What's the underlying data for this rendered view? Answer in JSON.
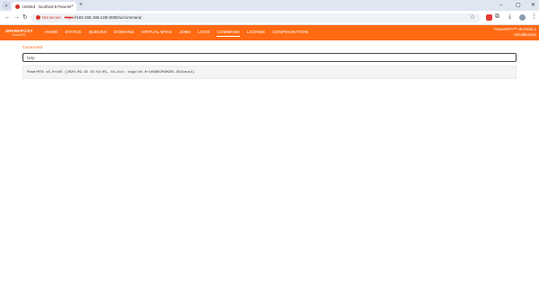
{
  "browser": {
    "tab_title": "Untitled - localhost:8 PowerMTA Web...",
    "new_tab_symbol": "+",
    "security_warning": "Not secure",
    "url_scheme": "https",
    "url_rest": "://192.168.198.128/:8080/ui/command",
    "window_controls": [
      "–",
      "▢",
      "✕"
    ]
  },
  "app": {
    "logo": "SPARKP☉ST",
    "logo_sub": "PowerMTA",
    "nav": [
      "HOME",
      "STATUS",
      "QUEUES",
      "DOMAINS",
      "VIRTUAL MTAS",
      "JOBS",
      "LOGS",
      "COMMAND",
      "LICENSE",
      "CONFIGURATION"
    ],
    "active_nav": "COMMAND",
    "version_line1": "PowerMTA™ v6.0r1b5.1",
    "version_line2": "r.localdomain"
  },
  "command": {
    "section_title": "Command",
    "input_value": "help",
    "output": "PowerMTA v6.0r1b5 (2020-09-16 15:54:05, 64-bit; tags/v6.0r1b5@ECM40956-2021auc1)"
  },
  "colors": {
    "brand": "#ff6a13",
    "warning": "#d93025"
  }
}
